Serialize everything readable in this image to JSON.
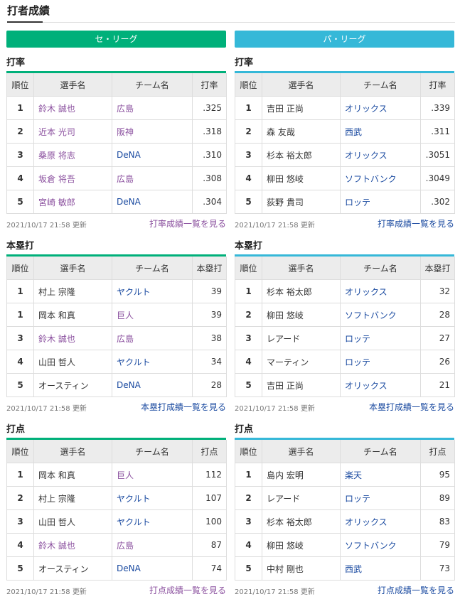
{
  "page_title": "打者成績",
  "leagues": {
    "central": "セ・リーグ",
    "pacific": "パ・リーグ"
  },
  "headers": {
    "rank": "順位",
    "player": "選手名",
    "team": "チーム名",
    "avg": "打率",
    "hr": "本塁打",
    "rbi": "打点"
  },
  "updated": "2021/10/17 21:58 更新",
  "sections": {
    "se_avg": {
      "title": "打率",
      "more": "打率成績一覧を見る",
      "rows": [
        {
          "rank": "1",
          "player": "鈴木 誠也",
          "team": "広島",
          "value": ".325"
        },
        {
          "rank": "2",
          "player": "近本 光司",
          "team": "阪神",
          "value": ".318"
        },
        {
          "rank": "3",
          "player": "桑原 将志",
          "team": "DeNA",
          "value": ".310"
        },
        {
          "rank": "4",
          "player": "坂倉 将吾",
          "team": "広島",
          "value": ".308"
        },
        {
          "rank": "5",
          "player": "宮崎 敏郎",
          "team": "DeNA",
          "value": ".304"
        }
      ]
    },
    "pa_avg": {
      "title": "打率",
      "more": "打率成績一覧を見る",
      "rows": [
        {
          "rank": "1",
          "player": "吉田 正尚",
          "team": "オリックス",
          "value": ".339"
        },
        {
          "rank": "2",
          "player": "森 友哉",
          "team": "西武",
          "value": ".311"
        },
        {
          "rank": "3",
          "player": "杉本 裕太郎",
          "team": "オリックス",
          "value": ".3051"
        },
        {
          "rank": "4",
          "player": "柳田 悠岐",
          "team": "ソフトバンク",
          "value": ".3049"
        },
        {
          "rank": "5",
          "player": "荻野 貴司",
          "team": "ロッテ",
          "value": ".302"
        }
      ]
    },
    "se_hr": {
      "title": "本塁打",
      "more": "本塁打成績一覧を見る",
      "rows": [
        {
          "rank": "1",
          "player": "村上 宗隆",
          "team": "ヤクルト",
          "value": "39"
        },
        {
          "rank": "1",
          "player": "岡本 和真",
          "team": "巨人",
          "value": "39"
        },
        {
          "rank": "3",
          "player": "鈴木 誠也",
          "team": "広島",
          "value": "38"
        },
        {
          "rank": "4",
          "player": "山田 哲人",
          "team": "ヤクルト",
          "value": "34"
        },
        {
          "rank": "5",
          "player": "オースティン",
          "team": "DeNA",
          "value": "28"
        }
      ]
    },
    "pa_hr": {
      "title": "本塁打",
      "more": "本塁打成績一覧を見る",
      "rows": [
        {
          "rank": "1",
          "player": "杉本 裕太郎",
          "team": "オリックス",
          "value": "32"
        },
        {
          "rank": "2",
          "player": "柳田 悠岐",
          "team": "ソフトバンク",
          "value": "28"
        },
        {
          "rank": "3",
          "player": "レアード",
          "team": "ロッテ",
          "value": "27"
        },
        {
          "rank": "4",
          "player": "マーティン",
          "team": "ロッテ",
          "value": "26"
        },
        {
          "rank": "5",
          "player": "吉田 正尚",
          "team": "オリックス",
          "value": "21"
        }
      ]
    },
    "se_rbi": {
      "title": "打点",
      "more": "打点成績一覧を見る",
      "rows": [
        {
          "rank": "1",
          "player": "岡本 和真",
          "team": "巨人",
          "value": "112"
        },
        {
          "rank": "2",
          "player": "村上 宗隆",
          "team": "ヤクルト",
          "value": "107"
        },
        {
          "rank": "3",
          "player": "山田 哲人",
          "team": "ヤクルト",
          "value": "100"
        },
        {
          "rank": "4",
          "player": "鈴木 誠也",
          "team": "広島",
          "value": "87"
        },
        {
          "rank": "5",
          "player": "オースティン",
          "team": "DeNA",
          "value": "74"
        }
      ]
    },
    "pa_rbi": {
      "title": "打点",
      "more": "打点成績一覧を見る",
      "rows": [
        {
          "rank": "1",
          "player": "島内 宏明",
          "team": "楽天",
          "value": "95"
        },
        {
          "rank": "2",
          "player": "レアード",
          "team": "ロッテ",
          "value": "89"
        },
        {
          "rank": "3",
          "player": "杉本 裕太郎",
          "team": "オリックス",
          "value": "83"
        },
        {
          "rank": "4",
          "player": "柳田 悠岐",
          "team": "ソフトバンク",
          "value": "79"
        },
        {
          "rank": "5",
          "player": "中村 剛也",
          "team": "西武",
          "value": "73"
        }
      ]
    }
  },
  "colors": {
    "central_accent": "#00b07a",
    "pacific_accent": "#35b8d8",
    "link": "#1a4aa0",
    "visited_link": "#8a4f9e"
  }
}
